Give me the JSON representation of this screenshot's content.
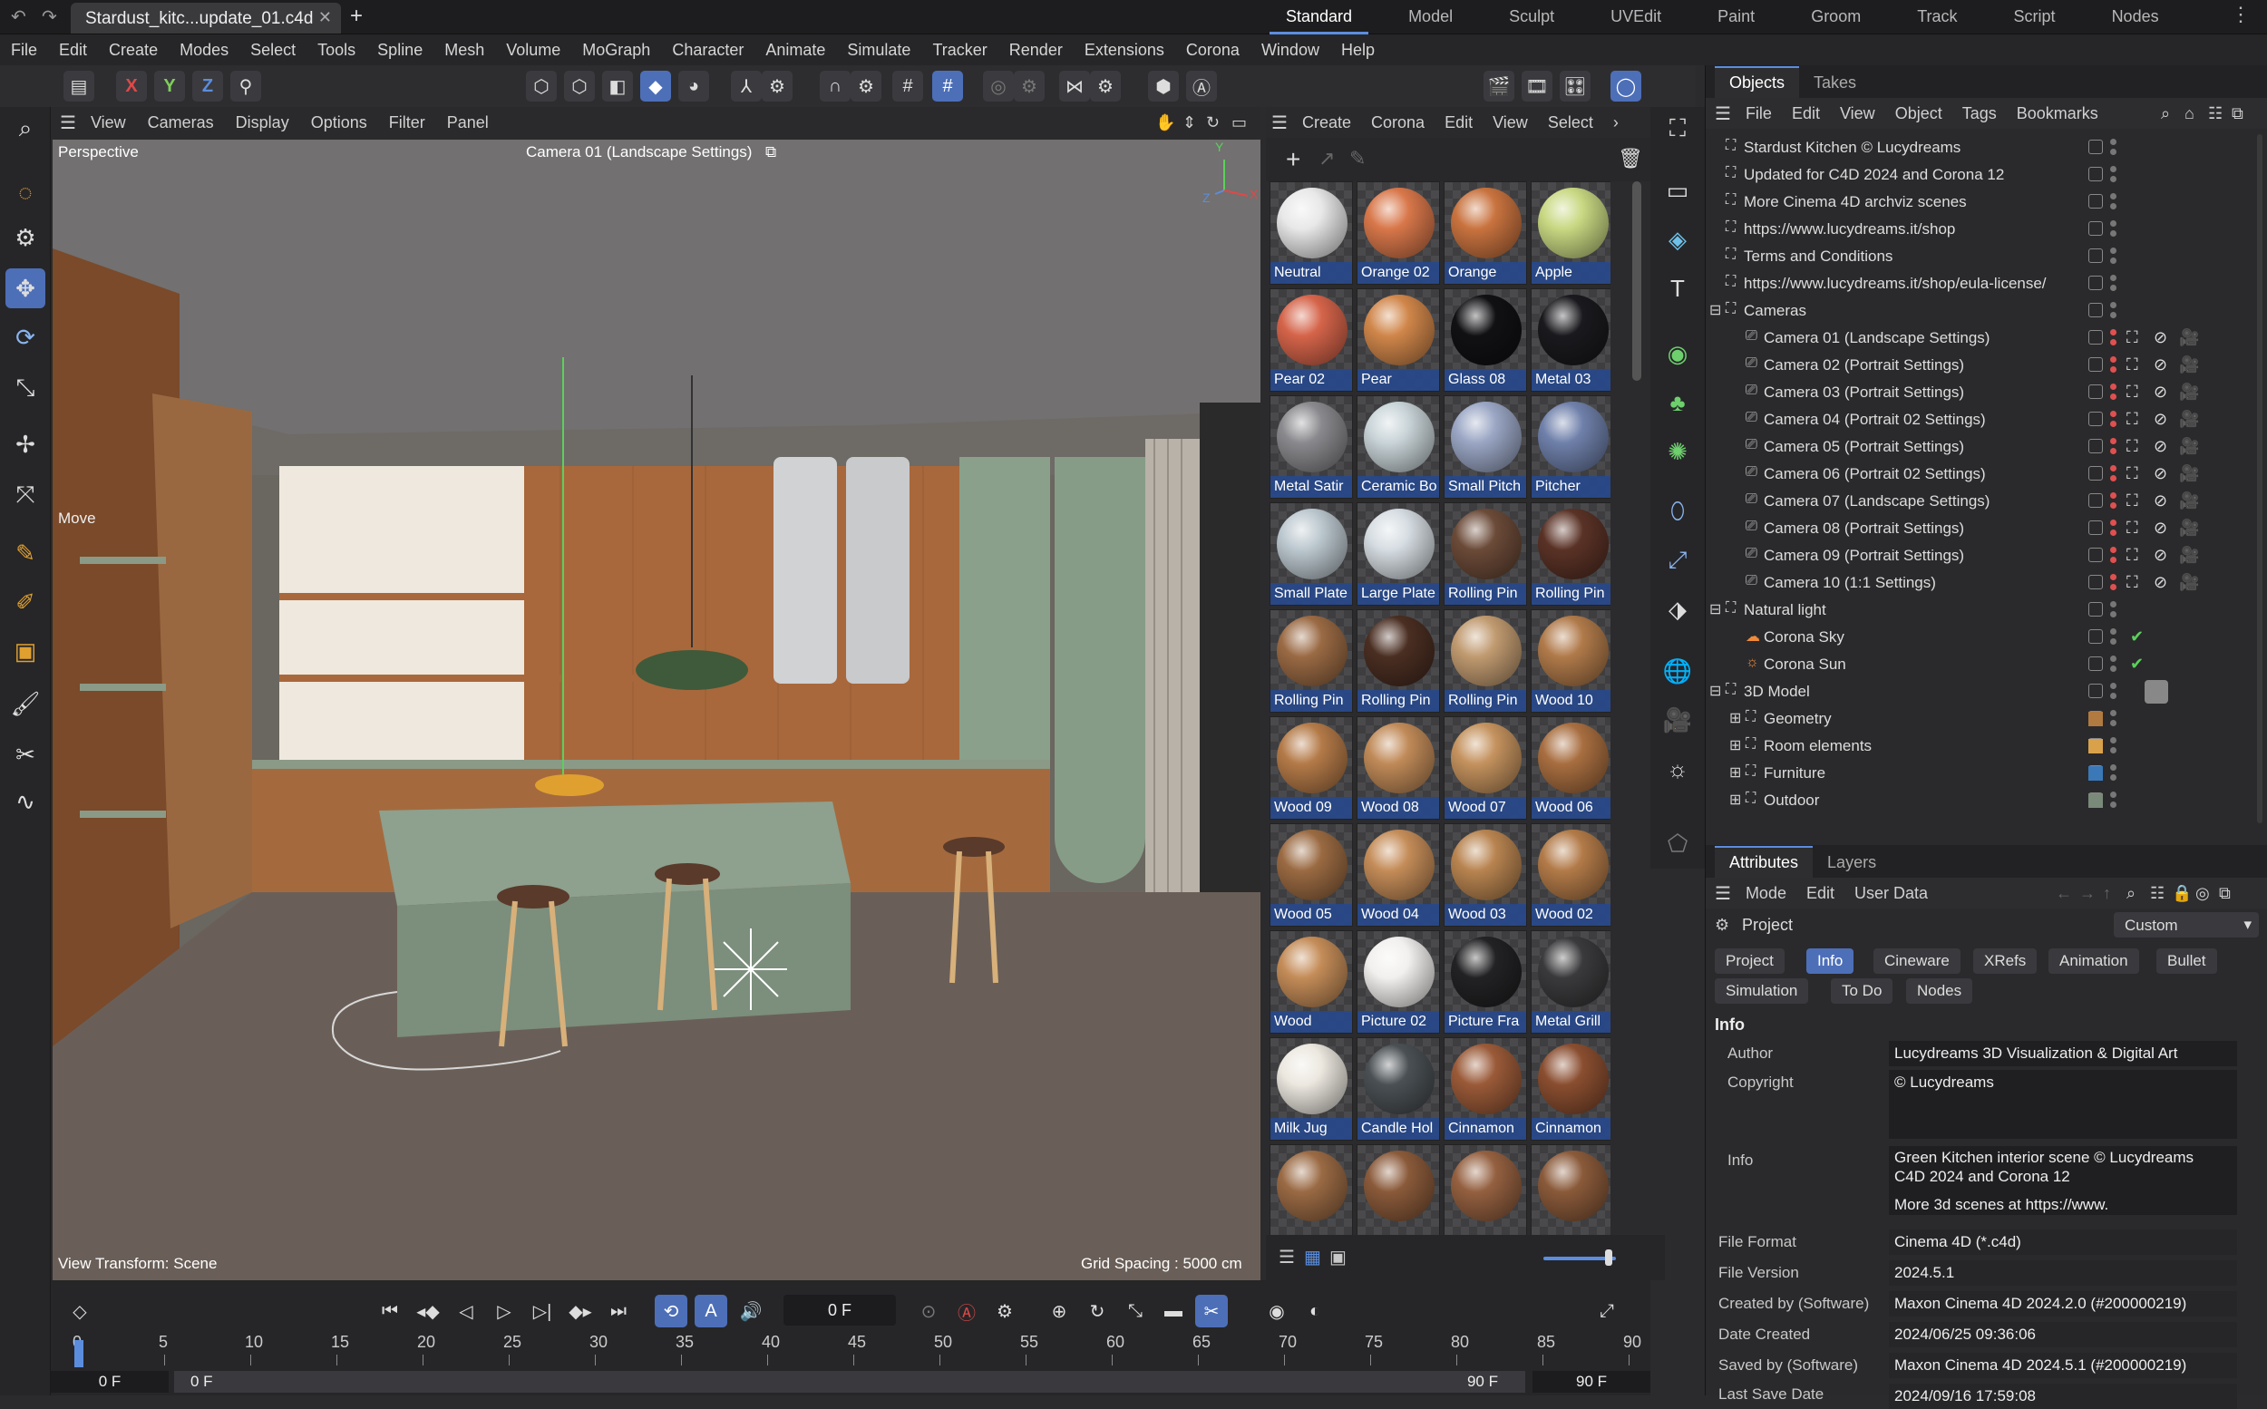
{
  "window": {
    "doc_tab": "Stardust_kitc...update_01.c4d",
    "layouts": [
      "Standard",
      "Model",
      "Sculpt",
      "UVEdit",
      "Paint",
      "Groom",
      "Track",
      "Script",
      "Nodes"
    ],
    "active_layout": "Standard"
  },
  "menubar": [
    "File",
    "Edit",
    "Create",
    "Modes",
    "Select",
    "Tools",
    "Spline",
    "Mesh",
    "Volume",
    "MoGraph",
    "Character",
    "Animate",
    "Simulate",
    "Tracker",
    "Render",
    "Extensions",
    "Corona",
    "Window",
    "Help"
  ],
  "viewport": {
    "menu": [
      "View",
      "Cameras",
      "Display",
      "Options",
      "Filter",
      "Panel"
    ],
    "view_name": "Perspective",
    "camera_label": "Camera 01 (Landscape Settings)",
    "tool_hint": "Move",
    "view_transform": "View Transform: Scene",
    "grid_spacing": "Grid Spacing : 5000 cm",
    "axis_y": "Y",
    "axis_x": "X",
    "axis_z": "Z"
  },
  "materials": {
    "menu": [
      "Create",
      "Corona",
      "Edit",
      "View",
      "Select"
    ],
    "items": [
      {
        "name": "Neutral",
        "color": "#e8e8e8"
      },
      {
        "name": "Orange 02",
        "color": "#d8774a"
      },
      {
        "name": "Orange",
        "color": "#c9733f"
      },
      {
        "name": "Apple",
        "color": "#c8d882"
      },
      {
        "name": "Pear 02",
        "color": "#d5644a"
      },
      {
        "name": "Pear",
        "color": "#d0864a"
      },
      {
        "name": "Glass 08",
        "color": "#111114"
      },
      {
        "name": "Metal 03",
        "color": "#1a1a1e"
      },
      {
        "name": "Metal Satir",
        "color": "#8a8a8e"
      },
      {
        "name": "Ceramic Bo",
        "color": "#c9d4d8"
      },
      {
        "name": "Small Pitch",
        "color": "#9aa6c4"
      },
      {
        "name": "Pitcher",
        "color": "#6f80aa"
      },
      {
        "name": "Small Plate",
        "color": "#bcc8cf"
      },
      {
        "name": "Large Plate",
        "color": "#d6dde2"
      },
      {
        "name": "Rolling Pin",
        "color": "#6b4a38"
      },
      {
        "name": "Rolling Pin",
        "color": "#5a3226"
      },
      {
        "name": "Rolling Pin",
        "color": "#9a6a44"
      },
      {
        "name": "Rolling Pin",
        "color": "#4a2e22"
      },
      {
        "name": "Rolling Pin",
        "color": "#c09a70"
      },
      {
        "name": "Wood 10",
        "color": "#b07a4a"
      },
      {
        "name": "Wood 09",
        "color": "#b47a48"
      },
      {
        "name": "Wood 08",
        "color": "#c08a58"
      },
      {
        "name": "Wood 07",
        "color": "#c4925e"
      },
      {
        "name": "Wood 06",
        "color": "#a86e40"
      },
      {
        "name": "Wood 05",
        "color": "#9a6a42"
      },
      {
        "name": "Wood 04",
        "color": "#c48c58"
      },
      {
        "name": "Wood 03",
        "color": "#b88450"
      },
      {
        "name": "Wood 02",
        "color": "#b27a48"
      },
      {
        "name": "Wood",
        "color": "#c48c58"
      },
      {
        "name": "Picture 02",
        "color": "#f2f0ee"
      },
      {
        "name": "Picture Fra",
        "color": "#222224"
      },
      {
        "name": "Metal Grill",
        "color": "#3a3a3c"
      },
      {
        "name": "Milk Jug",
        "color": "#ece8e0"
      },
      {
        "name": "Candle Hol",
        "color": "#4a5054"
      },
      {
        "name": "Cinnamon",
        "color": "#9a5a38"
      },
      {
        "name": "Cinnamon",
        "color": "#8a4e30"
      },
      {
        "name": "",
        "color": "#9a6a44"
      },
      {
        "name": "",
        "color": "#8a5a3a"
      },
      {
        "name": "",
        "color": "#946040"
      },
      {
        "name": "",
        "color": "#8a5a3a"
      }
    ]
  },
  "objects": {
    "tabs": [
      "Objects",
      "Takes"
    ],
    "menu": [
      "File",
      "Edit",
      "View",
      "Object",
      "Tags",
      "Bookmarks"
    ],
    "rows": [
      {
        "label": "Stardust Kitchen © Lucydreams",
        "indent": 0,
        "kind": "null"
      },
      {
        "label": "Updated for C4D 2024 and Corona 12",
        "indent": 0,
        "kind": "null"
      },
      {
        "label": "More Cinema 4D archviz scenes",
        "indent": 0,
        "kind": "null"
      },
      {
        "label": "https://www.lucydreams.it/shop",
        "indent": 0,
        "kind": "null"
      },
      {
        "label": "Terms and Conditions",
        "indent": 0,
        "kind": "null"
      },
      {
        "label": "https://www.lucydreams.it/shop/eula-license/",
        "indent": 0,
        "kind": "null"
      },
      {
        "label": "Cameras",
        "indent": 0,
        "kind": "group"
      },
      {
        "label": "Camera 01 (Landscape Settings)",
        "indent": 1,
        "kind": "camera"
      },
      {
        "label": "Camera 02 (Portrait Settings)",
        "indent": 1,
        "kind": "camera"
      },
      {
        "label": "Camera 03 (Portrait Settings)",
        "indent": 1,
        "kind": "camera"
      },
      {
        "label": "Camera 04 (Portrait 02 Settings)",
        "indent": 1,
        "kind": "camera"
      },
      {
        "label": "Camera 05 (Portrait Settings)",
        "indent": 1,
        "kind": "camera"
      },
      {
        "label": "Camera 06 (Portrait 02 Settings)",
        "indent": 1,
        "kind": "camera"
      },
      {
        "label": "Camera 07 (Landscape Settings)",
        "indent": 1,
        "kind": "camera"
      },
      {
        "label": "Camera 08 (Portrait Settings)",
        "indent": 1,
        "kind": "camera"
      },
      {
        "label": "Camera 09 (Portrait Settings)",
        "indent": 1,
        "kind": "camera"
      },
      {
        "label": "Camera 10 (1:1 Settings)",
        "indent": 1,
        "kind": "camera"
      },
      {
        "label": "Natural light",
        "indent": 0,
        "kind": "group"
      },
      {
        "label": "Corona Sky",
        "indent": 1,
        "kind": "sky"
      },
      {
        "label": "Corona Sun",
        "indent": 1,
        "kind": "sun"
      },
      {
        "label": "3D Model",
        "indent": 0,
        "kind": "group"
      },
      {
        "label": "Geometry",
        "indent": 1,
        "kind": "layer",
        "color": "#b07a40"
      },
      {
        "label": "Room elements",
        "indent": 1,
        "kind": "layer",
        "color": "#d9a24a"
      },
      {
        "label": "Furniture",
        "indent": 1,
        "kind": "layer",
        "color": "#3b78b8"
      },
      {
        "label": "Outdoor",
        "indent": 1,
        "kind": "layer",
        "color": "#7a8a7a"
      }
    ]
  },
  "attributes": {
    "tabs": [
      "Attributes",
      "Layers"
    ],
    "menu": [
      "Mode",
      "Edit",
      "User Data"
    ],
    "object_label": "Project",
    "preset": "Custom",
    "subtabs": [
      "Project",
      "Info",
      "Cineware",
      "XRefs",
      "Animation",
      "Bullet",
      "Simulation",
      "To Do",
      "Nodes"
    ],
    "active_subtab": "Info",
    "section": "Info",
    "fields": {
      "author_key": "Author",
      "author": "Lucydreams 3D Visualization & Digital Art",
      "copyright_key": "Copyright",
      "copyright": "© Lucydreams",
      "info_key": "Info",
      "info_line1": "Green Kitchen interior scene © Lucydreams",
      "info_line2": "C4D 2024 and Corona 12",
      "info_line3": "More 3d scenes at https://www.",
      "format_key": "File Format",
      "format": "Cinema 4D (*.c4d)",
      "version_key": "File Version",
      "version": "2024.5.1",
      "created_by_key": "Created by (Software)",
      "created_by": "Maxon Cinema 4D 2024.2.0 (#200000219)",
      "date_key": "Date Created",
      "date": "2024/06/25 09:36:06",
      "saved_by_key": "Saved by (Software)",
      "saved_by": "Maxon Cinema 4D 2024.5.1 (#200000219)",
      "last_key": "Last Save Date",
      "last": "2024/09/16 17:59:08"
    }
  },
  "timeline": {
    "current_frame": "0 F",
    "ticks": [
      "0",
      "5",
      "10",
      "15",
      "20",
      "25",
      "30",
      "35",
      "40",
      "45",
      "50",
      "55",
      "60",
      "65",
      "70",
      "75",
      "80",
      "85",
      "90"
    ],
    "range_start": "0 F",
    "range_start2": "0 F",
    "range_end": "90 F",
    "range_end2": "90 F"
  }
}
